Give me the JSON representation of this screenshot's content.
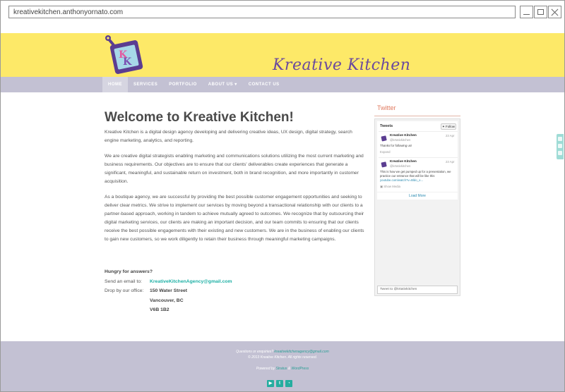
{
  "browser": {
    "url": "kreativekitchen.anthonyornato.com"
  },
  "header": {
    "brand": "Kreative Kitchen",
    "nav": [
      {
        "label": "HOME",
        "active": true
      },
      {
        "label": "SERVICES"
      },
      {
        "label": "PORTFOLIO"
      },
      {
        "label": "ABOUT US",
        "dropdown": true
      },
      {
        "label": "CONTACT US"
      }
    ]
  },
  "main": {
    "title": "Welcome to Kreative Kitchen!",
    "paragraphs": [
      "Kreative Kitchen is a digital design agency developing and delivering creative ideas, UX design, digital strategy, search engine marketing, analytics, and reporting.",
      "We are creative digital strategists enabling marketing and communications solutions utilizing the most current marketing and business requirements. Our objectives are to ensure that our clients' deliverables create experiences that generate a significant, meaningful, and sustainable return on investment, both in brand recognition, and more importantly in customer acquisition.",
      "As a boutique agency, we are successful by providing the best possible customer engagement opportunities and seeking to deliver clear metrics. We strive to implement our services by moving beyond a transactional relationship with our clients to a partner-based approach, working in tandem to achieve mutually agreed to outcomes. We recognize that by outsourcing their digital marketing services, our clients are making an important decision, and our team commits to ensuring that our clients receive the best possible engagements with their existing and new customers. We are in the business of enabling our clients to gain new customers, so we work diligently to retain their business through meaningful marketing campaigns."
    ],
    "contact": {
      "heading": "Hungry for answers?",
      "email_label": "Send an email to:",
      "email": "KreativeKitchenAgency@gmail.com",
      "office_label": "Drop by our office:",
      "address_line1": "150 Water Street",
      "address_line2": "Vancouver, BC",
      "address_line3": "V6B 1B2"
    }
  },
  "twitter": {
    "heading": "Twitter",
    "tweets_label": "Tweets",
    "follow_label": "Follow",
    "tweets": [
      {
        "name": "Kreative Kitchen",
        "handle": "@krtativkitchen",
        "date": "23 Apr",
        "text": "Thanks for following us!",
        "action": "Expand"
      },
      {
        "name": "Kreative Kitchen",
        "handle": "@krtativkitchen",
        "date": "23 Apr",
        "text": "This is how we get pumped up for a presentation, we practice our entrance that will be like this",
        "link": "youtube.com/watch?v=Bldo_o...",
        "action": "Show Media"
      }
    ],
    "load_more": "Load More",
    "input_placeholder": "Tweet to @krtativkitchen"
  },
  "footer": {
    "question": "Questions or enquiries?",
    "email": "kreativekitchenagency@gmail.com",
    "copyright": "© 2013 Kreative Kitchen. All rights reserved.",
    "powered_prefix": "Powered by",
    "powered_a": "Stratus",
    "powered_amp": "&",
    "powered_b": "WordPress",
    "icons": [
      "youtube-icon",
      "twitter-icon",
      "rss-icon"
    ]
  },
  "colors": {
    "banner": "#fde968",
    "nav": "#c3c1d3",
    "accent": "#1eb0a5",
    "brand": "#6a4a9e"
  }
}
